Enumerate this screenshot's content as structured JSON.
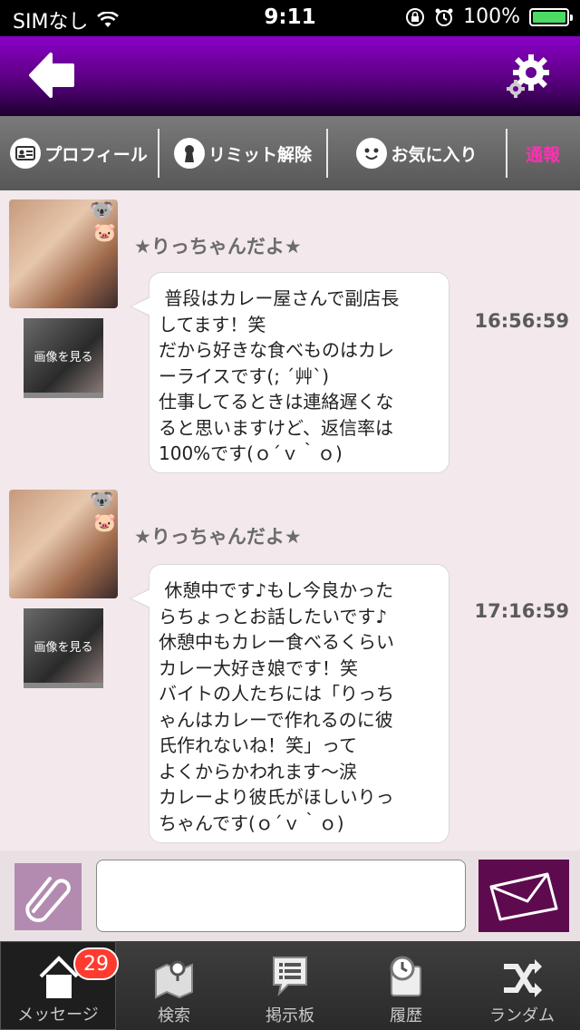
{
  "status_bar": {
    "carrier": "SIMなし",
    "time": "9:11",
    "battery": "100%"
  },
  "tabs": {
    "profile": "プロフィール",
    "limit_release": "リミット解除",
    "favorite": "お気に入り",
    "report": "通報"
  },
  "messages": [
    {
      "sender": "★りっちゃんだよ★",
      "photo_label": "画像を見る",
      "text": " 普段はカレー屋さんで副店長\nしてます！笑\nだから好きな食べものはカレ\nーライスです(; ´艸`)\n仕事してるときは連絡遅くな\nると思いますけど、返信率は\n100%です(ｏ´ｖ｀ｏ)",
      "time": "16:56:59"
    },
    {
      "sender": "★りっちゃんだよ★",
      "photo_label": "画像を見る",
      "text": " 休憩中です♪もし今良かった\nらちょっとお話したいです♪\n休憩中もカレー食べるくらい\nカレー大好き娘です！笑\nバイトの人たちには「りっち\nゃんはカレーで作れるのに彼\n氏作れないね！笑」って\nよくからかわれます〜涙\nカレーより彼氏がほしいりっ\nちゃんです(ｏ´ｖ｀ｏ)",
      "time": "17:16:59"
    }
  ],
  "bottom_nav": {
    "message": "メッセージ",
    "message_badge": "29",
    "search": "検索",
    "board": "掲示板",
    "history": "履歴",
    "random": "ランダム"
  }
}
